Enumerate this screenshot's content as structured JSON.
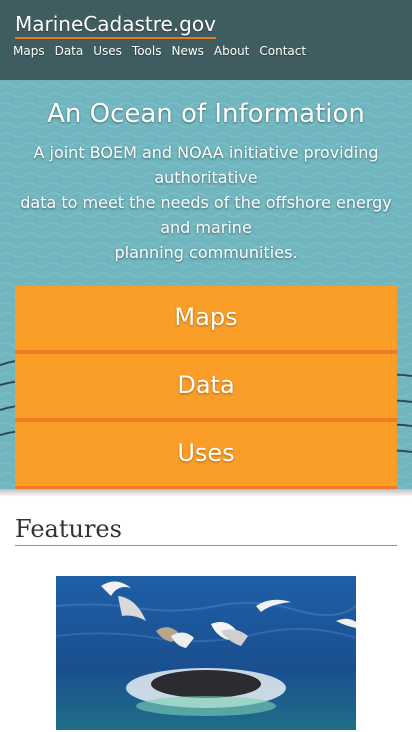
{
  "header": {
    "site_title": "MarineCadastre.gov",
    "nav": [
      "Maps",
      "Data",
      "Uses",
      "Tools",
      "News",
      "About",
      "Contact"
    ]
  },
  "hero": {
    "title": "An Ocean of Information",
    "subtitle_lines": [
      "A joint BOEM and NOAA initiative providing",
      "authoritative",
      "data to meet the needs of the offshore energy",
      "and marine",
      "planning communities."
    ],
    "buttons": [
      "Maps",
      "Data",
      "Uses"
    ]
  },
  "features": {
    "title": "Features",
    "image_icon": "seagulls-whale-photo"
  },
  "colors": {
    "header_bg": "#3f5d60",
    "hero_bg": "#71b6bf",
    "button_bg": "#fb9e27",
    "accent": "#e87722"
  }
}
